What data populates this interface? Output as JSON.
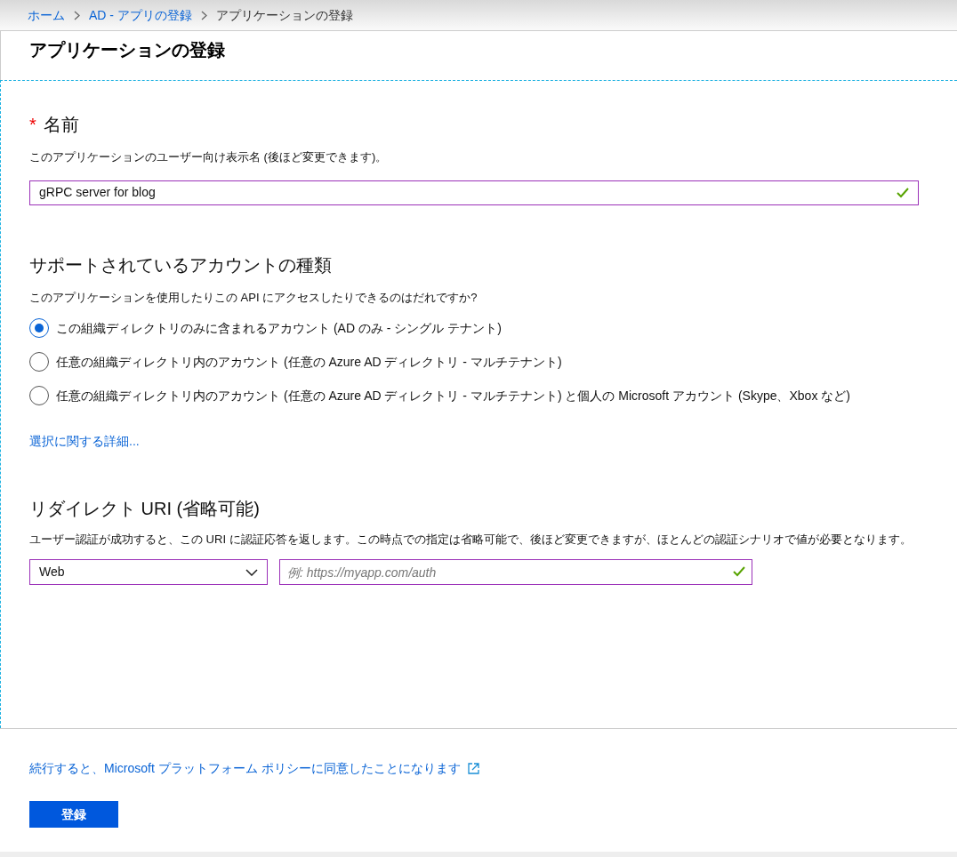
{
  "breadcrumb": [
    {
      "label": "ホーム",
      "kind": "link"
    },
    {
      "label": "AD - アプリの登録",
      "kind": "link"
    },
    {
      "label": "アプリケーションの登録",
      "kind": "current"
    }
  ],
  "title": "アプリケーションの登録",
  "name_section": {
    "label": "名前",
    "required_mark": "*",
    "description": "このアプリケーションのユーザー向け表示名 (後ほど変更できます)。",
    "value": "gRPC server for blog",
    "valid": true
  },
  "account_section": {
    "heading": "サポートされているアカウントの種類",
    "question": "このアプリケーションを使用したりこの API にアクセスしたりできるのはだれですか?",
    "options": [
      {
        "label": "この組織ディレクトリのみに含まれるアカウント (AD のみ - シングル テナント)",
        "selected": true
      },
      {
        "label": "任意の組織ディレクトリ内のアカウント (任意の Azure AD ディレクトリ - マルチテナント)",
        "selected": false
      },
      {
        "label": "任意の組織ディレクトリ内のアカウント (任意の Azure AD ディレクトリ - マルチテナント) と個人の Microsoft アカウント (Skype、Xbox など)",
        "selected": false
      }
    ],
    "help_link": "選択に関する詳細..."
  },
  "redirect_section": {
    "heading": "リダイレクト URI (省略可能)",
    "description": "ユーザー認証が成功すると、この URI に認証応答を返します。この時点での指定は省略可能で、後ほど変更できますが、ほとんどの認証シナリオで値が必要となります。",
    "platform": "Web",
    "uri_placeholder": "例: https://myapp.com/auth",
    "valid": true
  },
  "footer": {
    "policy_link": "続行すると、Microsoft プラットフォーム ポリシーに同意したことになります",
    "register_button": "登録"
  }
}
